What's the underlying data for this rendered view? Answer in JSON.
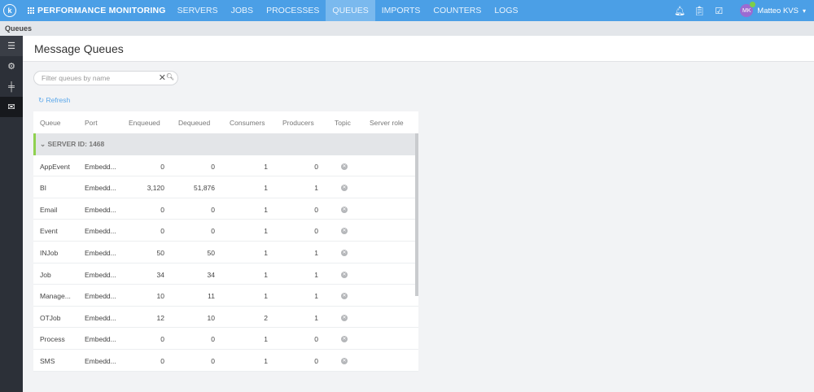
{
  "nav": {
    "brand": "PERFORMANCE MONITORING",
    "items": [
      "SERVERS",
      "JOBS",
      "PROCESSES",
      "QUEUES",
      "IMPORTS",
      "COUNTERS",
      "LOGS"
    ],
    "active": "QUEUES",
    "user": {
      "initials": "MK",
      "name": "Matteo KVS"
    }
  },
  "breadcrumb": "Queues",
  "page": {
    "title": "Message Queues",
    "search_placeholder": "Filter queues by name",
    "refresh": "Refresh"
  },
  "table": {
    "columns": [
      "Queue",
      "Port",
      "Enqueued",
      "Dequeued",
      "Consumers",
      "Producers",
      "Topic",
      "Server role"
    ],
    "group": "SERVER ID: 1468",
    "rows": [
      [
        "AppEvent",
        "Embedd...",
        "0",
        "0",
        "1",
        "0"
      ],
      [
        "BI",
        "Embedd...",
        "3,120",
        "51,876",
        "1",
        "1"
      ],
      [
        "Email",
        "Embedd...",
        "0",
        "0",
        "1",
        "0"
      ],
      [
        "Event",
        "Embedd...",
        "0",
        "0",
        "1",
        "0"
      ],
      [
        "INJob",
        "Embedd...",
        "50",
        "50",
        "1",
        "1"
      ],
      [
        "Job",
        "Embedd...",
        "34",
        "34",
        "1",
        "1"
      ],
      [
        "Manage...",
        "Embedd...",
        "10",
        "11",
        "1",
        "1"
      ],
      [
        "OTJob",
        "Embedd...",
        "12",
        "10",
        "2",
        "1"
      ],
      [
        "Process",
        "Embedd...",
        "0",
        "0",
        "1",
        "0"
      ],
      [
        "SMS",
        "Embedd...",
        "0",
        "0",
        "1",
        "0"
      ]
    ]
  }
}
